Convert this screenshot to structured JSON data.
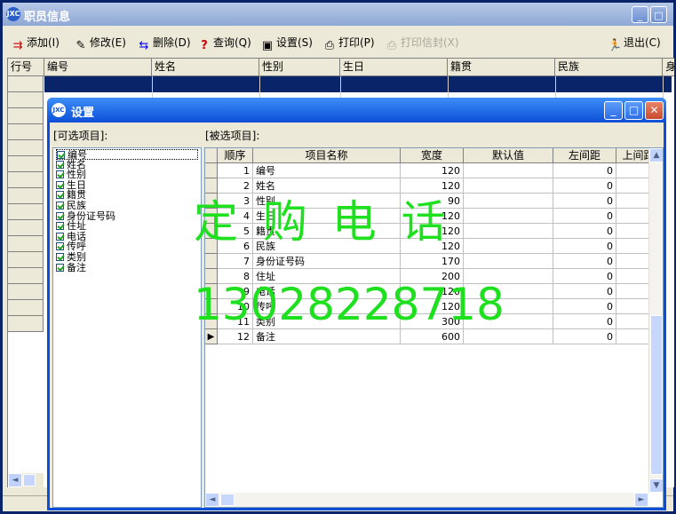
{
  "main_window": {
    "title": "职员信息"
  },
  "toolbar": {
    "add": "添加(I)",
    "edit": "修改(E)",
    "delete": "删除(D)",
    "query": "查询(Q)",
    "settings": "设置(S)",
    "print": "打印(P)",
    "print_envelope": "打印信封(X)",
    "exit": "退出(C)"
  },
  "main_grid": {
    "columns": [
      "行号",
      "编号",
      "姓名",
      "性别",
      "生日",
      "籍贯",
      "民族",
      "身"
    ]
  },
  "dialog": {
    "title": "设置",
    "available_label": "[可选项目]:",
    "selected_label": "[被选项目]:",
    "available_items": [
      "编号",
      "姓名",
      "性别",
      "生日",
      "籍贯",
      "民族",
      "身份证号码",
      "住址",
      "电话",
      "传呼",
      "类别",
      "备注"
    ],
    "columns": [
      "顺序",
      "项目名称",
      "宽度",
      "默认值",
      "左间距",
      "上间距"
    ],
    "rows": [
      {
        "order": "1",
        "name": "编号",
        "width": "120",
        "default": "",
        "left": "0"
      },
      {
        "order": "2",
        "name": "姓名",
        "width": "120",
        "default": "",
        "left": "0"
      },
      {
        "order": "3",
        "name": "性别",
        "width": "90",
        "default": "",
        "left": "0"
      },
      {
        "order": "4",
        "name": "生日",
        "width": "120",
        "default": "",
        "left": "0"
      },
      {
        "order": "5",
        "name": "籍贯",
        "width": "120",
        "default": "",
        "left": "0"
      },
      {
        "order": "6",
        "name": "民族",
        "width": "120",
        "default": "",
        "left": "0"
      },
      {
        "order": "7",
        "name": "身份证号码",
        "width": "170",
        "default": "",
        "left": "0"
      },
      {
        "order": "8",
        "name": "住址",
        "width": "200",
        "default": "",
        "left": "0"
      },
      {
        "order": "9",
        "name": "电话",
        "width": "120",
        "default": "",
        "left": "0"
      },
      {
        "order": "10",
        "name": "传呼",
        "width": "120",
        "default": "",
        "left": "0"
      },
      {
        "order": "11",
        "name": "类别",
        "width": "300",
        "default": "",
        "left": "0"
      },
      {
        "order": "12",
        "name": "备注",
        "width": "600",
        "default": "",
        "left": "0"
      }
    ]
  },
  "watermark": {
    "line1": "定 购 电 话",
    "line2": "13028228718"
  },
  "colors": {
    "selection": "#0a246a",
    "dialog_title": "#0b4fd8",
    "watermark": "#1fe01f"
  }
}
